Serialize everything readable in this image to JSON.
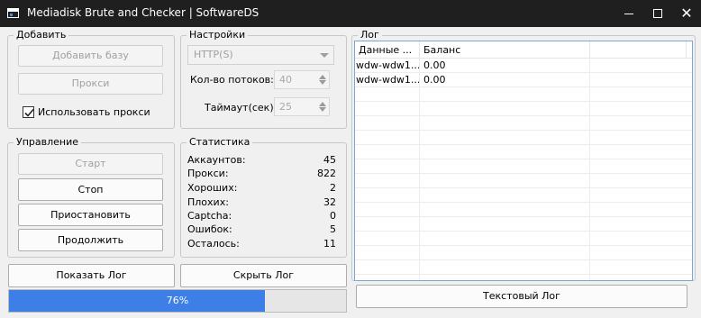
{
  "window": {
    "title": "Mediadisk Brute and Checker | SoftwareDS"
  },
  "add_group": {
    "title": "Добавить",
    "add_base_label": "Добавить базу",
    "proxy_label": "Прокси",
    "use_proxy_label": "Использовать прокси",
    "use_proxy_checked": true
  },
  "settings_group": {
    "title": "Настройки",
    "protocol_value": "HTTP(S)",
    "threads_label": "Кол-во потоков:",
    "threads_value": "40",
    "timeout_label": "Таймаут(сек):",
    "timeout_value": "25"
  },
  "control_group": {
    "title": "Управление",
    "start_label": "Старт",
    "stop_label": "Стоп",
    "pause_label": "Приостановить",
    "continue_label": "Продолжить"
  },
  "stats_group": {
    "title": "Статистика",
    "rows": [
      {
        "label": "Аккаунтов:",
        "value": "45"
      },
      {
        "label": "Прокси:",
        "value": "822"
      },
      {
        "label": "Хороших:",
        "value": "2"
      },
      {
        "label": "Плохих:",
        "value": "32"
      },
      {
        "label": "Captcha:",
        "value": "0"
      },
      {
        "label": "Ошибок:",
        "value": "5"
      },
      {
        "label": "Осталось:",
        "value": "11"
      }
    ]
  },
  "bottom": {
    "show_log_label": "Показать Лог",
    "hide_log_label": "Скрыть Лог",
    "progress_text": "76%",
    "progress_value": 76
  },
  "log_group": {
    "title": "Лог",
    "columns": [
      "Данные ...",
      "Баланс",
      ""
    ],
    "rows": [
      {
        "data": "wdw-wdw1...",
        "balance": "0.00"
      },
      {
        "data": "wdw-wdw1...",
        "balance": "0.00"
      }
    ],
    "text_log_label": "Текстовый Лог"
  },
  "colors": {
    "accent": "#3d7fe6",
    "titlebar": "#1f1f1f",
    "listview_border": "#7aa7d6"
  }
}
